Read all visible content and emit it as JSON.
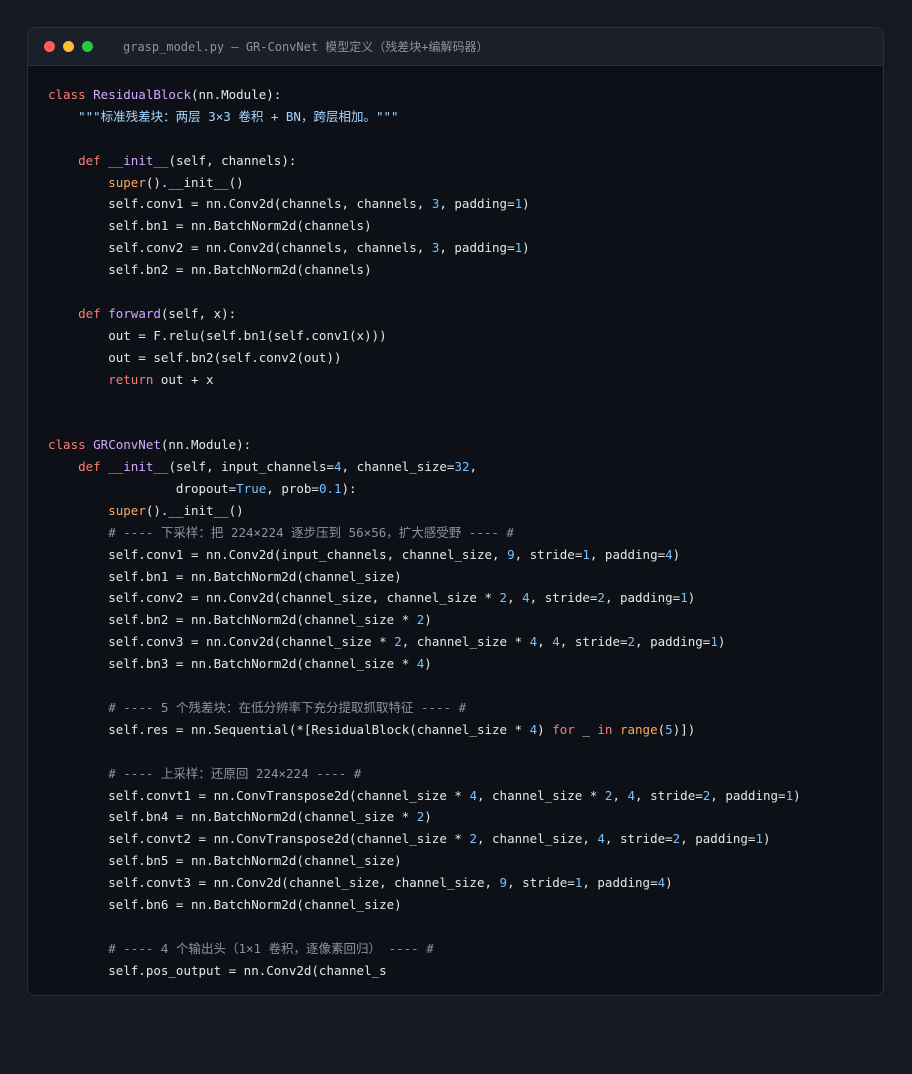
{
  "window": {
    "title": "grasp_model.py — GR-ConvNet 模型定义（残差块+编解码器）",
    "dots": [
      "#ff5f57",
      "#febc2e",
      "#28c840"
    ]
  },
  "lines": [
    [
      {
        "t": "class ",
        "c": "kw"
      },
      {
        "t": "ResidualBlock",
        "c": "cls"
      },
      {
        "t": "(nn.Module):",
        "c": "txt"
      }
    ],
    [
      {
        "t": "    ",
        "c": "txt"
      },
      {
        "t": "\"\"\"标准残差块：两层 3×3 卷积 + BN，跨层相加。\"\"\"",
        "c": "str"
      }
    ],
    [],
    [
      {
        "t": "    ",
        "c": "txt"
      },
      {
        "t": "def ",
        "c": "kw"
      },
      {
        "t": "__init__",
        "c": "fn"
      },
      {
        "t": "(self, channels):",
        "c": "txt"
      }
    ],
    [
      {
        "t": "        ",
        "c": "txt"
      },
      {
        "t": "super",
        "c": "bi"
      },
      {
        "t": "().__init__()",
        "c": "txt"
      }
    ],
    [
      {
        "t": "        self.conv1 = nn.Conv2d(channels, channels, ",
        "c": "txt"
      },
      {
        "t": "3",
        "c": "num"
      },
      {
        "t": ", padding=",
        "c": "txt"
      },
      {
        "t": "1",
        "c": "num"
      },
      {
        "t": ")",
        "c": "txt"
      }
    ],
    [
      {
        "t": "        self.bn1 = nn.BatchNorm2d(channels)",
        "c": "txt"
      }
    ],
    [
      {
        "t": "        self.conv2 = nn.Conv2d(channels, channels, ",
        "c": "txt"
      },
      {
        "t": "3",
        "c": "num"
      },
      {
        "t": ", padding=",
        "c": "txt"
      },
      {
        "t": "1",
        "c": "num"
      },
      {
        "t": ")",
        "c": "txt"
      }
    ],
    [
      {
        "t": "        self.bn2 = nn.BatchNorm2d(channels)",
        "c": "txt"
      }
    ],
    [],
    [
      {
        "t": "    ",
        "c": "txt"
      },
      {
        "t": "def ",
        "c": "kw"
      },
      {
        "t": "forward",
        "c": "fn"
      },
      {
        "t": "(self, x):",
        "c": "txt"
      }
    ],
    [
      {
        "t": "        out = F.relu(self.bn1(self.conv1(x)))",
        "c": "txt"
      }
    ],
    [
      {
        "t": "        out = self.bn2(self.conv2(out))",
        "c": "txt"
      }
    ],
    [
      {
        "t": "        ",
        "c": "txt"
      },
      {
        "t": "return ",
        "c": "kw"
      },
      {
        "t": "out + x",
        "c": "txt"
      }
    ],
    [],
    [],
    [
      {
        "t": "class ",
        "c": "kw"
      },
      {
        "t": "GRConvNet",
        "c": "cls"
      },
      {
        "t": "(nn.Module):",
        "c": "txt"
      }
    ],
    [
      {
        "t": "    ",
        "c": "txt"
      },
      {
        "t": "def ",
        "c": "kw"
      },
      {
        "t": "__init__",
        "c": "fn"
      },
      {
        "t": "(self, input_channels=",
        "c": "txt"
      },
      {
        "t": "4",
        "c": "num"
      },
      {
        "t": ", channel_size=",
        "c": "txt"
      },
      {
        "t": "32",
        "c": "num"
      },
      {
        "t": ",",
        "c": "txt"
      }
    ],
    [
      {
        "t": "                 dropout=",
        "c": "txt"
      },
      {
        "t": "True",
        "c": "num"
      },
      {
        "t": ", prob=",
        "c": "txt"
      },
      {
        "t": "0.1",
        "c": "num"
      },
      {
        "t": "):",
        "c": "txt"
      }
    ],
    [
      {
        "t": "        ",
        "c": "txt"
      },
      {
        "t": "super",
        "c": "bi"
      },
      {
        "t": "().__init__()",
        "c": "txt"
      }
    ],
    [
      {
        "t": "        ",
        "c": "txt"
      },
      {
        "t": "# ---- 下采样：把 224×224 逐步压到 56×56，扩大感受野 ---- #",
        "c": "cm"
      }
    ],
    [
      {
        "t": "        self.conv1 = nn.Conv2d(input_channels, channel_size, ",
        "c": "txt"
      },
      {
        "t": "9",
        "c": "num"
      },
      {
        "t": ", stride=",
        "c": "txt"
      },
      {
        "t": "1",
        "c": "num"
      },
      {
        "t": ", padding=",
        "c": "txt"
      },
      {
        "t": "4",
        "c": "num"
      },
      {
        "t": ")",
        "c": "txt"
      }
    ],
    [
      {
        "t": "        self.bn1 = nn.BatchNorm2d(channel_size)",
        "c": "txt"
      }
    ],
    [
      {
        "t": "        self.conv2 = nn.Conv2d(channel_size, channel_size * ",
        "c": "txt"
      },
      {
        "t": "2",
        "c": "num"
      },
      {
        "t": ", ",
        "c": "txt"
      },
      {
        "t": "4",
        "c": "num"
      },
      {
        "t": ", stride=",
        "c": "txt"
      },
      {
        "t": "2",
        "c": "num"
      },
      {
        "t": ", padding=",
        "c": "txt"
      },
      {
        "t": "1",
        "c": "num"
      },
      {
        "t": ")",
        "c": "txt"
      }
    ],
    [
      {
        "t": "        self.bn2 = nn.BatchNorm2d(channel_size * ",
        "c": "txt"
      },
      {
        "t": "2",
        "c": "num"
      },
      {
        "t": ")",
        "c": "txt"
      }
    ],
    [
      {
        "t": "        self.conv3 = nn.Conv2d(channel_size * ",
        "c": "txt"
      },
      {
        "t": "2",
        "c": "num"
      },
      {
        "t": ", channel_size * ",
        "c": "txt"
      },
      {
        "t": "4",
        "c": "num"
      },
      {
        "t": ", ",
        "c": "txt"
      },
      {
        "t": "4",
        "c": "num"
      },
      {
        "t": ", stride=",
        "c": "txt"
      },
      {
        "t": "2",
        "c": "num"
      },
      {
        "t": ", padding=",
        "c": "txt"
      },
      {
        "t": "1",
        "c": "num"
      },
      {
        "t": ")",
        "c": "txt"
      }
    ],
    [
      {
        "t": "        self.bn3 = nn.BatchNorm2d(channel_size * ",
        "c": "txt"
      },
      {
        "t": "4",
        "c": "num"
      },
      {
        "t": ")",
        "c": "txt"
      }
    ],
    [],
    [
      {
        "t": "        ",
        "c": "txt"
      },
      {
        "t": "# ---- 5 个残差块：在低分辨率下充分提取抓取特征 ---- #",
        "c": "cm"
      }
    ],
    [
      {
        "t": "        self.res = nn.Sequential(*[ResidualBlock(channel_size * ",
        "c": "txt"
      },
      {
        "t": "4",
        "c": "num"
      },
      {
        "t": ") ",
        "c": "txt"
      },
      {
        "t": "for ",
        "c": "kw"
      },
      {
        "t": "_ ",
        "c": "txt"
      },
      {
        "t": "in ",
        "c": "kw"
      },
      {
        "t": "range",
        "c": "bi"
      },
      {
        "t": "(",
        "c": "txt"
      },
      {
        "t": "5",
        "c": "num"
      },
      {
        "t": ")])",
        "c": "txt"
      }
    ],
    [],
    [
      {
        "t": "        ",
        "c": "txt"
      },
      {
        "t": "# ---- 上采样：还原回 224×224 ---- #",
        "c": "cm"
      }
    ],
    [
      {
        "t": "        self.convt1 = nn.ConvTranspose2d(channel_size * ",
        "c": "txt"
      },
      {
        "t": "4",
        "c": "num"
      },
      {
        "t": ", channel_size * ",
        "c": "txt"
      },
      {
        "t": "2",
        "c": "num"
      },
      {
        "t": ", ",
        "c": "txt"
      },
      {
        "t": "4",
        "c": "num"
      },
      {
        "t": ", stride=",
        "c": "txt"
      },
      {
        "t": "2",
        "c": "num"
      },
      {
        "t": ", padding=",
        "c": "txt"
      },
      {
        "t": "1",
        "c": "num"
      },
      {
        "t": ")",
        "c": "txt"
      }
    ],
    [
      {
        "t": "        self.bn4 = nn.BatchNorm2d(channel_size * ",
        "c": "txt"
      },
      {
        "t": "2",
        "c": "num"
      },
      {
        "t": ")",
        "c": "txt"
      }
    ],
    [
      {
        "t": "        self.convt2 = nn.ConvTranspose2d(channel_size * ",
        "c": "txt"
      },
      {
        "t": "2",
        "c": "num"
      },
      {
        "t": ", channel_size, ",
        "c": "txt"
      },
      {
        "t": "4",
        "c": "num"
      },
      {
        "t": ", stride=",
        "c": "txt"
      },
      {
        "t": "2",
        "c": "num"
      },
      {
        "t": ", padding=",
        "c": "txt"
      },
      {
        "t": "1",
        "c": "num"
      },
      {
        "t": ")",
        "c": "txt"
      }
    ],
    [
      {
        "t": "        self.bn5 = nn.BatchNorm2d(channel_size)",
        "c": "txt"
      }
    ],
    [
      {
        "t": "        self.convt3 = nn.Conv2d(channel_size, channel_size, ",
        "c": "txt"
      },
      {
        "t": "9",
        "c": "num"
      },
      {
        "t": ", stride=",
        "c": "txt"
      },
      {
        "t": "1",
        "c": "num"
      },
      {
        "t": ", padding=",
        "c": "txt"
      },
      {
        "t": "4",
        "c": "num"
      },
      {
        "t": ")",
        "c": "txt"
      }
    ],
    [
      {
        "t": "        self.bn6 = nn.BatchNorm2d(channel_size)",
        "c": "txt"
      }
    ],
    [],
    [
      {
        "t": "        ",
        "c": "txt"
      },
      {
        "t": "# ---- 4 个输出头（1×1 卷积，逐像素回归） ---- #",
        "c": "cm"
      }
    ],
    [
      {
        "t": "        self.pos_output = nn.Conv2d(channel_s",
        "c": "txt"
      }
    ]
  ]
}
